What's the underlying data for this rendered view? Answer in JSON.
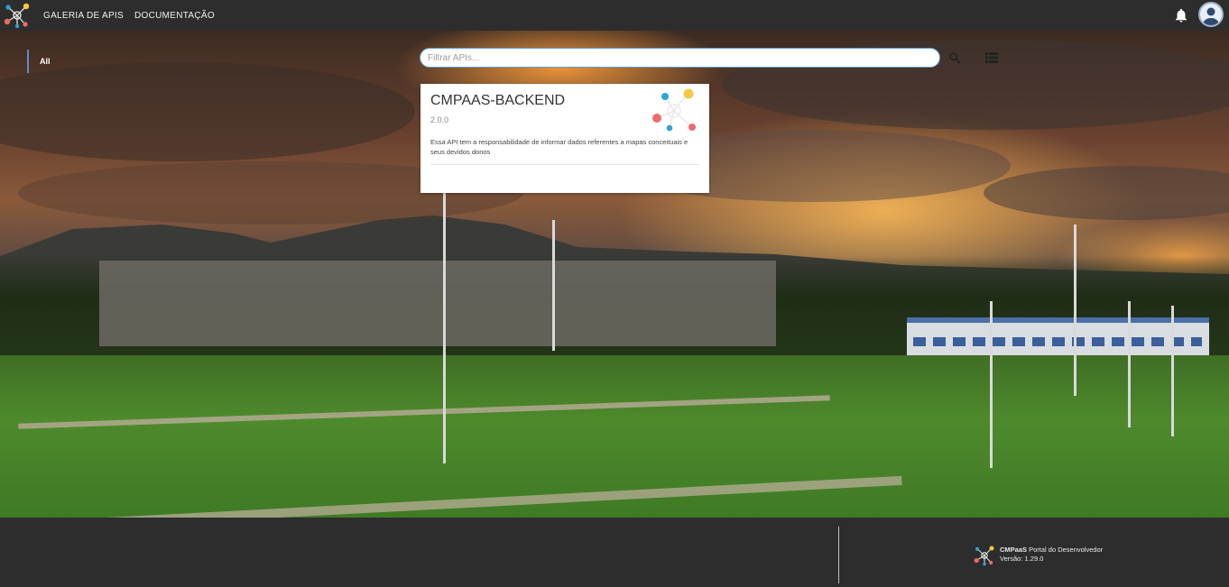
{
  "nav": {
    "links": [
      "GALERIA DE APIS",
      "DOCUMENTAÇÃO"
    ]
  },
  "sidebar": {
    "filter": "All"
  },
  "search": {
    "placeholder": "Filtrar APIs..."
  },
  "cards": [
    {
      "title": "CMPAAS-BACKEND",
      "version": "2.0.0",
      "description": "Essa API tem a responsabilidade de informar dados referentes a mapas conceituais e seus devidos donos"
    }
  ],
  "footer": {
    "brand": "CMPaaS",
    "subtitle": "Portal do Desenvolvedor",
    "version": "Versão: 1.29.0"
  },
  "colors": {
    "topbar": "#2d2d2d",
    "accent": "#5b9bd5",
    "logo_yellow": "#f6c945",
    "logo_blue": "#2aa7d6",
    "logo_red": "#ef6a6a"
  },
  "icons": [
    "logo-icon",
    "bell-icon",
    "user-avatar-icon",
    "search-icon",
    "list-view-icon"
  ]
}
